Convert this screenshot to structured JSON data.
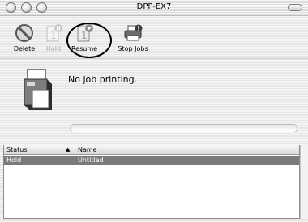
{
  "window": {
    "title": "DPP-EX7"
  },
  "toolbar": {
    "delete_label": "Delete",
    "hold_label": "Hold",
    "resume_label": "Resume",
    "stop_jobs_label": "Stop Jobs"
  },
  "status": {
    "message": "No job printing."
  },
  "job_list": {
    "columns": [
      "Status",
      "Name"
    ],
    "rows": [
      {
        "status": "Hold",
        "name": "Untitled"
      }
    ]
  },
  "icons": {
    "delete": "no-entry-icon",
    "hold": "pause-document-icon",
    "resume": "resume-document-icon",
    "stop_jobs": "printer-stop-icon",
    "printer": "printer-icon"
  }
}
